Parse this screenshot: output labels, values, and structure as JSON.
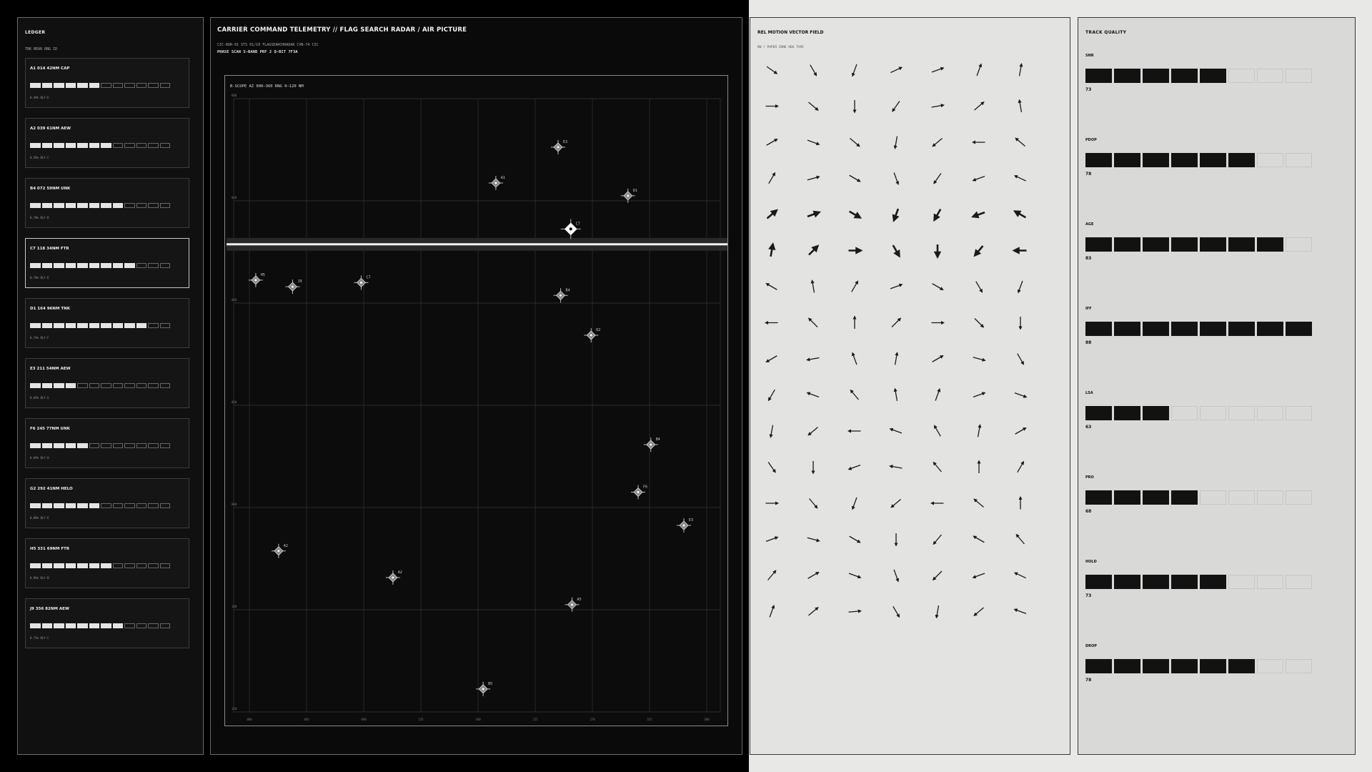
{
  "ledger": {
    "title": "LEDGER",
    "subtitle": "TRK BEAR RNG ID",
    "items": [
      {
        "label": "A1 014 42NM CAP",
        "segments": 6,
        "meta": "0.49% DLY·E",
        "selected": false
      },
      {
        "label": "A2 039 61NM AEW",
        "segments": 7,
        "meta": "0.56% DLY·C",
        "selected": false
      },
      {
        "label": "B4 072 59NM UNK",
        "segments": 8,
        "meta": "0.78% DLY·D",
        "selected": false
      },
      {
        "label": "C7 118 34NM FTR",
        "segments": 9,
        "meta": "0.78% DLY·E",
        "selected": true
      },
      {
        "label": "D1 164 96NM TNK",
        "segments": 10,
        "meta": "0.74% DLY·F",
        "selected": false
      },
      {
        "label": "E3 211 54NM AEW",
        "segments": 4,
        "meta": "0.69% DLY·G",
        "selected": false
      },
      {
        "label": "F6 245 77NM UNK",
        "segments": 5,
        "meta": "0.69% DLY·H",
        "selected": false
      },
      {
        "label": "G2 292 41NM HELO",
        "segments": 6,
        "meta": "0.88% DLY·E",
        "selected": false
      },
      {
        "label": "H5 331 69NM FTR",
        "segments": 7,
        "meta": "0.96% DLY·B",
        "selected": false
      },
      {
        "label": "J9 356 82NM AEW",
        "segments": 8,
        "meta": "0.73% DLY·C",
        "selected": false
      }
    ]
  },
  "radar": {
    "title": "CARRIER COMMAND TELEMETRY // FLAG SEARCH RADAR / AIR PICTURE",
    "subtitle1": "CIC-RDR-01 STS 01/10 FLAGSEARCHRADAR CVN-74 CIC",
    "subtitle2": "PHASE SCAN S-BAND PRF 2 Q-BIT 7F3A",
    "scope_title": "B-SCOPE AZ 000–360 RNG 0–120 NM",
    "x_ticks": [
      "000",
      "045",
      "090",
      "135",
      "180",
      "225",
      "270",
      "315",
      "360"
    ],
    "y_ticks": [
      "000",
      "020",
      "040",
      "060",
      "080",
      "100",
      "120"
    ],
    "sweep_range": 28.5,
    "contacts": [
      {
        "id": "E3",
        "bear": 243,
        "range": 9.5
      },
      {
        "id": "A1",
        "bear": 194,
        "range": 16.5
      },
      {
        "id": "D1",
        "bear": 298,
        "range": 19
      },
      {
        "id": "C7",
        "bear": 253,
        "range": 25.5,
        "selected": true
      },
      {
        "id": "H5",
        "bear": 5,
        "range": 35.5
      },
      {
        "id": "J9",
        "bear": 34,
        "range": 36.8
      },
      {
        "id": "C7",
        "bear": 88,
        "range": 36
      },
      {
        "id": "B4",
        "bear": 245,
        "range": 38.5
      },
      {
        "id": "D2",
        "bear": 269,
        "range": 46.3
      },
      {
        "id": "B4",
        "bear": 316,
        "range": 67.7
      },
      {
        "id": "F6",
        "bear": 306,
        "range": 77
      },
      {
        "id": "E3",
        "bear": 342,
        "range": 83.5
      },
      {
        "id": "A2",
        "bear": 23,
        "range": 88.5
      },
      {
        "id": "A2",
        "bear": 113,
        "range": 93.7
      },
      {
        "id": "A5",
        "bear": 254,
        "range": 99
      },
      {
        "id": "B5",
        "bear": 184,
        "range": 115.5
      }
    ]
  },
  "vector": {
    "title": "REL MOTION VECTOR FIELD",
    "subtitle": "BW / PAPER ZONE HDG TAPE",
    "rows": [
      [
        35,
        60,
        110,
        -25,
        -20,
        -70,
        -80
      ],
      [
        0,
        40,
        90,
        125,
        -10,
        -40,
        -100
      ],
      [
        -30,
        20,
        40,
        100,
        140,
        180,
        -140
      ],
      [
        -60,
        -15,
        30,
        70,
        125,
        160,
        -155
      ],
      [
        -40,
        -20,
        30,
        110,
        120,
        160,
        -150
      ],
      [
        -80,
        -45,
        0,
        60,
        90,
        130,
        180
      ],
      [
        -150,
        -100,
        -60,
        -20,
        30,
        60,
        110
      ],
      [
        180,
        -135,
        -90,
        -45,
        0,
        45,
        90
      ],
      [
        150,
        170,
        -110,
        -80,
        -30,
        15,
        60
      ],
      [
        120,
        -160,
        -130,
        -100,
        -70,
        -20,
        20
      ],
      [
        100,
        140,
        180,
        -160,
        -120,
        -80,
        -30
      ],
      [
        55,
        90,
        160,
        -170,
        -130,
        -90,
        -60
      ],
      [
        0,
        50,
        110,
        140,
        180,
        -140,
        -90
      ],
      [
        -20,
        15,
        30,
        90,
        130,
        -150,
        -130
      ],
      [
        -50,
        -30,
        20,
        70,
        135,
        160,
        -155
      ],
      [
        -70,
        -40,
        -5,
        60,
        100,
        140,
        -160
      ]
    ],
    "bold_rows": [
      4,
      5
    ]
  },
  "quality": {
    "title": "TRACK QUALITY",
    "metrics": [
      {
        "label": "SNR",
        "value": "73",
        "filled": 5
      },
      {
        "label": "PDOP",
        "value": "78",
        "filled": 6
      },
      {
        "label": "AGE",
        "value": "83",
        "filled": 7
      },
      {
        "label": "IFF",
        "value": "88",
        "filled": 8
      },
      {
        "label": "LSA",
        "value": "63",
        "filled": 3
      },
      {
        "label": "PRO",
        "value": "68",
        "filled": 4
      },
      {
        "label": "HOLD",
        "value": "73",
        "filled": 5
      },
      {
        "label": "DROP",
        "value": "78",
        "filled": 6
      }
    ]
  }
}
